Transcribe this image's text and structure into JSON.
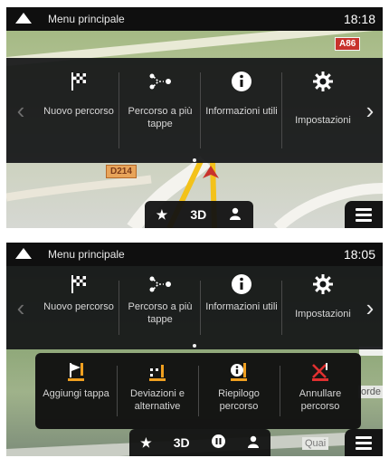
{
  "screen1": {
    "status": {
      "title": "Menu principale",
      "time": "18:18"
    },
    "map": {
      "road_sign_major": "A86",
      "road_sign_minor": "D214"
    },
    "menu": {
      "items": [
        {
          "label": "Nuovo percorso",
          "icon": "checkered-flag-icon"
        },
        {
          "label": "Percorso a più tappe",
          "icon": "multi-stop-route-icon"
        },
        {
          "label": "Informazioni utili",
          "icon": "info-icon"
        },
        {
          "label": "Impostazioni",
          "icon": "gear-icon"
        }
      ]
    },
    "bottom_bar": {
      "view_mode": "3D",
      "icons": [
        "star-icon",
        "person-icon"
      ]
    }
  },
  "screen2": {
    "status": {
      "title": "Menu principale",
      "time": "18:05"
    },
    "map": {
      "street_label": "orde",
      "street_label_2": "Quai"
    },
    "menu": {
      "items": [
        {
          "label": "Nuovo percorso",
          "icon": "checkered-flag-icon"
        },
        {
          "label": "Percorso a più tappe",
          "icon": "multi-stop-route-icon"
        },
        {
          "label": "Informazioni utili",
          "icon": "info-icon"
        },
        {
          "label": "Impostazioni",
          "icon": "gear-icon"
        }
      ]
    },
    "submenu": {
      "items": [
        {
          "label": "Aggiungi tappa",
          "icon": "add-waypoint-icon"
        },
        {
          "label": "Deviazioni e alternative",
          "icon": "detour-icon"
        },
        {
          "label": "Riepilogo percorso",
          "icon": "route-summary-icon"
        },
        {
          "label": "Annullare percorso",
          "icon": "cancel-route-icon"
        }
      ]
    },
    "bottom_bar": {
      "view_mode": "3D",
      "icons": [
        "star-icon",
        "pause-icon",
        "person-icon"
      ]
    }
  },
  "colors": {
    "accent": "#f0a020",
    "cancel_red": "#e03030",
    "panel": "#141618"
  }
}
